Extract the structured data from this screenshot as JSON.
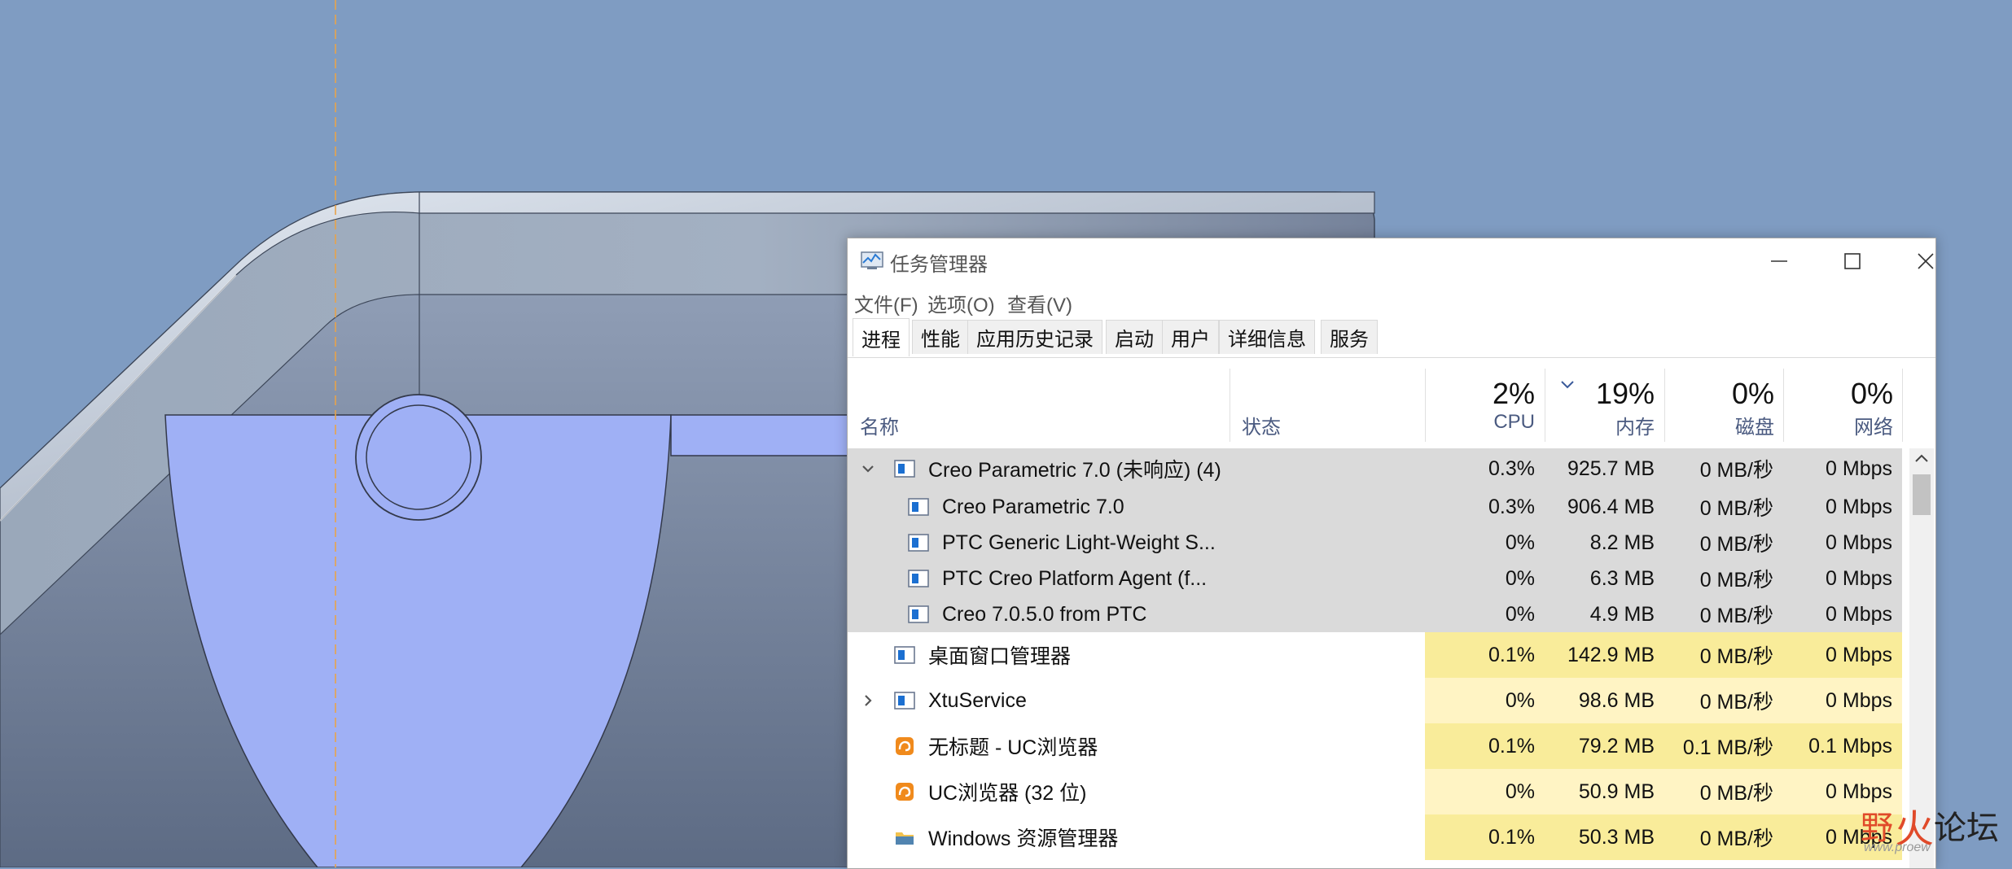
{
  "window": {
    "title": "任务管理器",
    "controls": {
      "minimize": "—",
      "maximize": "☐",
      "close": "✕"
    }
  },
  "menu": [
    "文件(F)",
    "选项(O)",
    "查看(V)"
  ],
  "tabs": [
    "进程",
    "性能",
    "应用历史记录",
    "启动",
    "用户",
    "详细信息",
    "服务"
  ],
  "active_tab": "进程",
  "columns": {
    "name": "名称",
    "status": "状态",
    "cpu": {
      "pct": "2%",
      "label": "CPU"
    },
    "mem": {
      "pct": "19%",
      "label": "内存"
    },
    "disk": {
      "pct": "0%",
      "label": "磁盘"
    },
    "net": {
      "pct": "0%",
      "label": "网络"
    }
  },
  "rows": [
    {
      "name": "Creo Parametric 7.0 (未响应) (4)",
      "cpu": "0.3%",
      "mem": "925.7 MB",
      "disk": "0 MB/秒",
      "net": "0 Mbps",
      "icon": "app-window-icon",
      "expanded": true,
      "group": true
    },
    {
      "name": "Creo Parametric 7.0",
      "cpu": "0.3%",
      "mem": "906.4 MB",
      "disk": "0 MB/秒",
      "net": "0 Mbps",
      "icon": "app-window-icon",
      "child": true
    },
    {
      "name": "PTC Generic Light-Weight S...",
      "cpu": "0%",
      "mem": "8.2 MB",
      "disk": "0 MB/秒",
      "net": "0 Mbps",
      "icon": "app-window-icon",
      "child": true
    },
    {
      "name": "PTC Creo Platform Agent (f...",
      "cpu": "0%",
      "mem": "6.3 MB",
      "disk": "0 MB/秒",
      "net": "0 Mbps",
      "icon": "app-window-icon",
      "child": true
    },
    {
      "name": "Creo 7.0.5.0 from PTC",
      "cpu": "0%",
      "mem": "4.9 MB",
      "disk": "0 MB/秒",
      "net": "0 Mbps",
      "icon": "app-window-icon",
      "child": true
    },
    {
      "name": "桌面窗口管理器",
      "cpu": "0.1%",
      "mem": "142.9 MB",
      "disk": "0 MB/秒",
      "net": "0 Mbps",
      "icon": "app-window-icon"
    },
    {
      "name": "XtuService",
      "cpu": "0%",
      "mem": "98.6 MB",
      "disk": "0 MB/秒",
      "net": "0 Mbps",
      "icon": "app-window-icon",
      "collapsed": true
    },
    {
      "name": "无标题 - UC浏览器",
      "cpu": "0.1%",
      "mem": "79.2 MB",
      "disk": "0.1 MB/秒",
      "net": "0.1 Mbps",
      "icon": "uc-browser-icon"
    },
    {
      "name": "UC浏览器 (32 位)",
      "cpu": "0%",
      "mem": "50.9 MB",
      "disk": "0 MB/秒",
      "net": "0 Mbps",
      "icon": "uc-browser-icon"
    },
    {
      "name": "Windows 资源管理器",
      "cpu": "0.1%",
      "mem": "50.3 MB",
      "disk": "0 MB/秒",
      "net": "0 Mbps",
      "icon": "folder-icon"
    }
  ],
  "watermark": {
    "text1": "野",
    "text2": "火",
    "text3": "论坛",
    "sub": "www.proew"
  },
  "colors": {
    "background": "#7f9cc2",
    "part_fill": "#9fb0f5",
    "group_row": "#dadada",
    "heat_light": "#fff4c4",
    "heat_mid": "#f9ec9a",
    "accent_blue": "#1b6fd1"
  }
}
